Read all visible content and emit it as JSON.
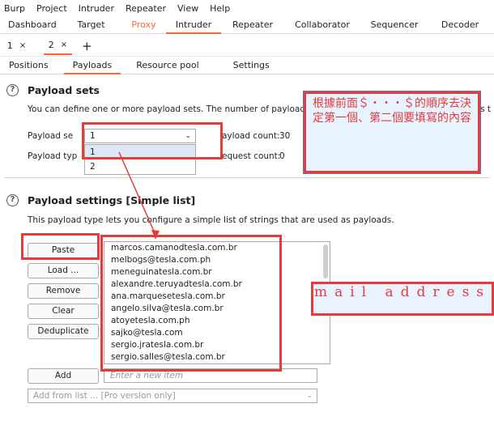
{
  "menu": [
    "Burp",
    "Project",
    "Intruder",
    "Repeater",
    "View",
    "Help"
  ],
  "tool_tabs": [
    "Dashboard",
    "Target",
    "Proxy",
    "Intruder",
    "Repeater",
    "Collaborator",
    "Sequencer",
    "Decoder"
  ],
  "active_tool_tab": "Intruder",
  "attack_tabs": [
    {
      "label": "1",
      "close": "×"
    },
    {
      "label": "2",
      "close": "×"
    }
  ],
  "new_tab": "+",
  "inner_tabs": [
    "Positions",
    "Payloads",
    "Resource pool",
    "Settings"
  ],
  "active_inner_tab": "Payloads",
  "payload_sets": {
    "title": "Payload sets",
    "description": "You can define one or more payload sets. The number of payload sets d",
    "description_tail": "ons t",
    "set_label": "Payload se",
    "type_label": "Payload typ",
    "set_value": "1",
    "set_options": [
      "1",
      "2"
    ],
    "count_label": "ayload count:",
    "count_value": "30",
    "request_label": "equest count:",
    "request_value": "0"
  },
  "payload_settings": {
    "title": "Payload settings [Simple list]",
    "description": "This payload type lets you configure a simple list of strings that are used as payloads.",
    "buttons": {
      "paste": "Paste",
      "load": "Load ...",
      "remove": "Remove",
      "clear": "Clear",
      "deduplicate": "Deduplicate",
      "add": "Add"
    },
    "items": [
      "marcos.camanodtesla.com.br",
      "melbogs@tesla.com.ph",
      "meneguinatesla.com.br",
      "alexandre.teruyadtesla.com.br",
      "ana.marquesetesla.com.br",
      "angelo.silva@tesla.com.br",
      "atoyetesla.com.ph",
      "sajko@tesla.com",
      "sergio.jratesla.com.br",
      "sergio.salles@tesla.com.br"
    ],
    "new_item_placeholder": "Enter a new item",
    "add_from_list": "Add from list ... [Pro version only]"
  },
  "help_glyph": "?",
  "annotations": {
    "order_note": "根據前面＄・・・＄的順序去決定第一個、第二個要填寫的內容",
    "mail_note": "mail address"
  },
  "colors": {
    "accent": "#ff6633",
    "annotation_red": "#e53b3b",
    "note_bg": "#e7f3ff"
  }
}
